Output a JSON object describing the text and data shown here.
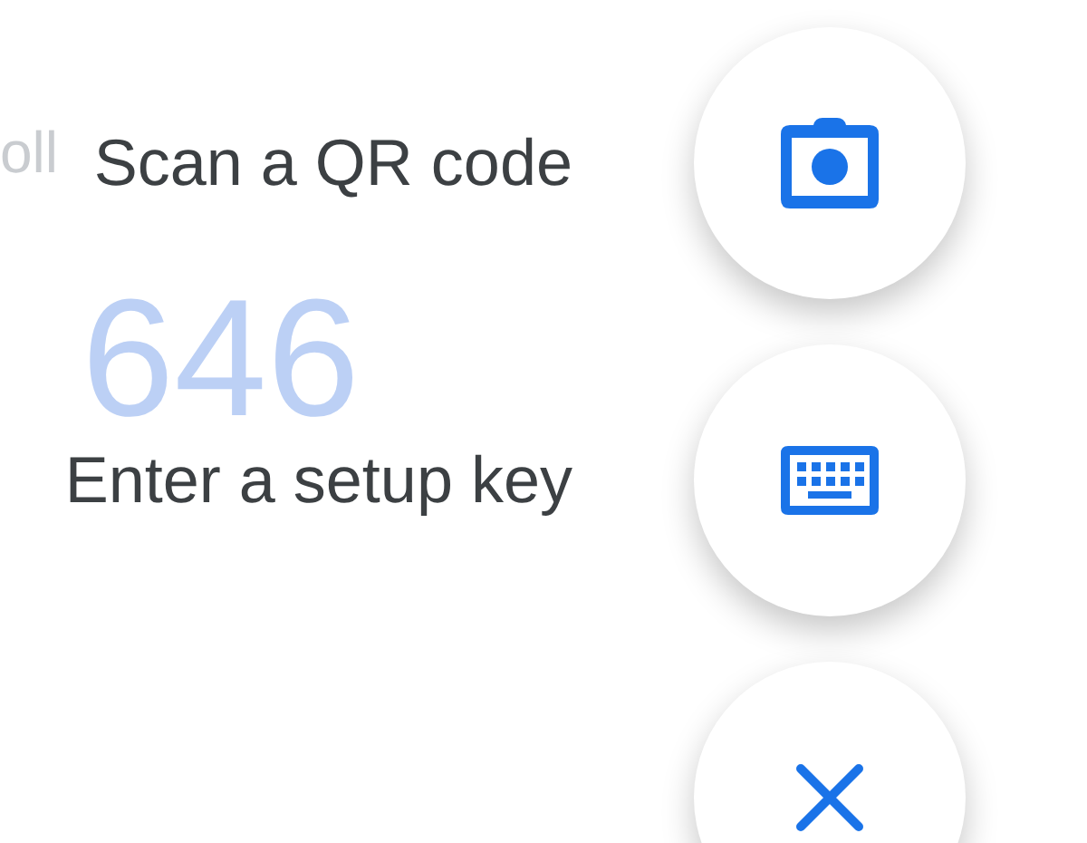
{
  "background": {
    "account_fragment": "oll",
    "code": "646"
  },
  "actions": [
    {
      "kind": "camera",
      "label": "Scan a QR code"
    },
    {
      "kind": "keyboard",
      "label": "Enter a setup key"
    },
    {
      "kind": "close"
    }
  ]
}
